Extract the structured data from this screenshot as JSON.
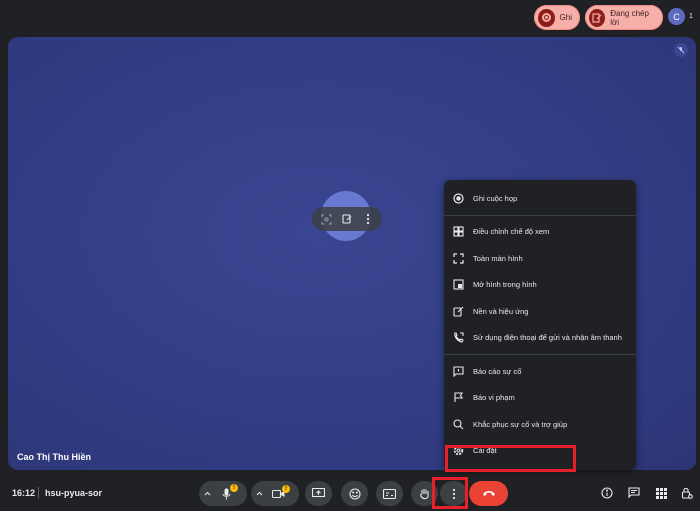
{
  "topbar": {
    "record_label": "Ghi",
    "captions_label": "Đang chép lời",
    "avatar_letter": "C",
    "participant_count": "1"
  },
  "stage": {
    "participant_name": "Cao Thị Thu Hiền"
  },
  "menu": {
    "items": [
      {
        "label": "Ghi cuộc họp",
        "icon": "record-icon"
      },
      {
        "label": "Điều chỉnh chế độ xem",
        "icon": "layout-icon"
      },
      {
        "label": "Toàn màn hình",
        "icon": "fullscreen-icon"
      },
      {
        "label": "Mở hình trong hình",
        "icon": "pip-icon"
      },
      {
        "label": "Nền và hiệu ứng",
        "icon": "effects-icon"
      },
      {
        "label": "Sử dụng điện thoại để gửi và nhận âm thanh",
        "icon": "phone-audio-icon"
      },
      {
        "label": "Báo cáo sự cố",
        "icon": "report-problem-icon"
      },
      {
        "label": "Báo vi phạm",
        "icon": "report-abuse-icon"
      },
      {
        "label": "Khắc phục sự cố và trợ giúp",
        "icon": "troubleshoot-icon"
      },
      {
        "label": "Cài đặt",
        "icon": "settings-icon"
      }
    ]
  },
  "bottombar": {
    "time": "16:12",
    "meeting_code": "hsu-pyua-sor",
    "warning_mark": "!"
  },
  "colors": {
    "stage_bg": "#333d86",
    "end_call": "#ea4335",
    "highlight": "#e8202a",
    "pill_bg": "#f6aea9"
  }
}
